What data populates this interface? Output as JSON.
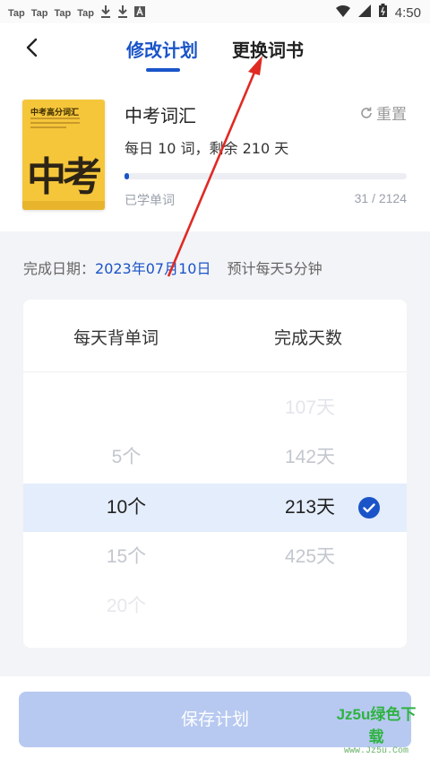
{
  "status_bar": {
    "left_items": [
      "Tap",
      "Tap",
      "Tap",
      "Tap"
    ],
    "time": "4:50",
    "icons": [
      "download-icon",
      "download-icon",
      "a-box-icon",
      "wifi-icon",
      "signal-icon",
      "battery-icon"
    ]
  },
  "nav": {
    "tabs": [
      {
        "label": "修改计划",
        "active": true
      },
      {
        "label": "更换词书",
        "active": false
      }
    ]
  },
  "book": {
    "cover_title": "中考高分词汇",
    "cover_big": "中考",
    "title": "中考词汇",
    "reset_label": "重置",
    "subtitle": "每日 10 词，剩余 210 天",
    "learned_label": "已学单词",
    "learned_count": "31 / 2124",
    "progress": 0.0146
  },
  "plan": {
    "finish_label": "完成日期：",
    "finish_date": "2023年07月10日",
    "estimate": "预计每天5分钟",
    "col_left": "每天背单词",
    "col_right": "完成天数",
    "rows": [
      {
        "left": "",
        "right": "107天"
      },
      {
        "left": "5个",
        "right": "142天"
      },
      {
        "left": "10个",
        "right": "213天",
        "selected": true
      },
      {
        "left": "15个",
        "right": "425天"
      },
      {
        "left": "20个",
        "right": ""
      }
    ]
  },
  "save_label": "保存计划",
  "watermark": {
    "main": "Jz5u绿色下载",
    "sub": "www.Jz5u.Com"
  },
  "colors": {
    "accent": "#1a54c8",
    "selected_row": "#e4edfc",
    "save_disabled": "#b7c9f0",
    "annotation_arrow": "#e02a24"
  }
}
